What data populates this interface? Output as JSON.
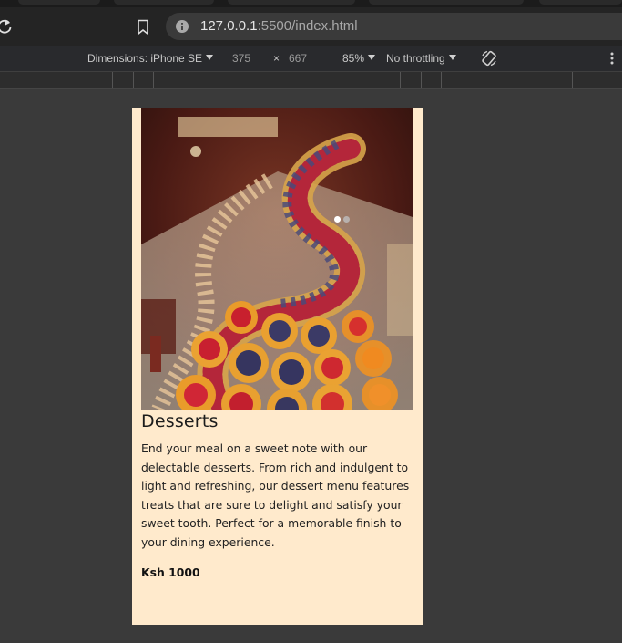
{
  "browser": {
    "url_host": "127.0.0.1",
    "url_rest": ":5500/index.html"
  },
  "devtools": {
    "dimensions_label": "Dimensions: iPhone SE",
    "width": "375",
    "times": "×",
    "height": "667",
    "zoom": "85%",
    "throttling": "No throttling"
  },
  "icons": {
    "reload": "reload-icon",
    "bookmark": "bookmark-icon",
    "site_info": "info-icon",
    "rotate": "rotate-icon",
    "more": "more-vert-icon"
  },
  "card": {
    "carousel": {
      "slides": 2,
      "active_slide": 1
    },
    "title": "Desserts",
    "description": "End your meal on a sweet note with our delectable desserts. From rich and indulgent to light and refreshing, our dessert menu features treats that are sure to delight and satisfy your sweet tooth. Perfect for a memorable finish to your dining experience.",
    "price": "Ksh 1000"
  },
  "colors": {
    "page_bg": "#3a3a3a",
    "card_bg": "#ffeacc",
    "toolbar_bg": "#292a2d"
  }
}
